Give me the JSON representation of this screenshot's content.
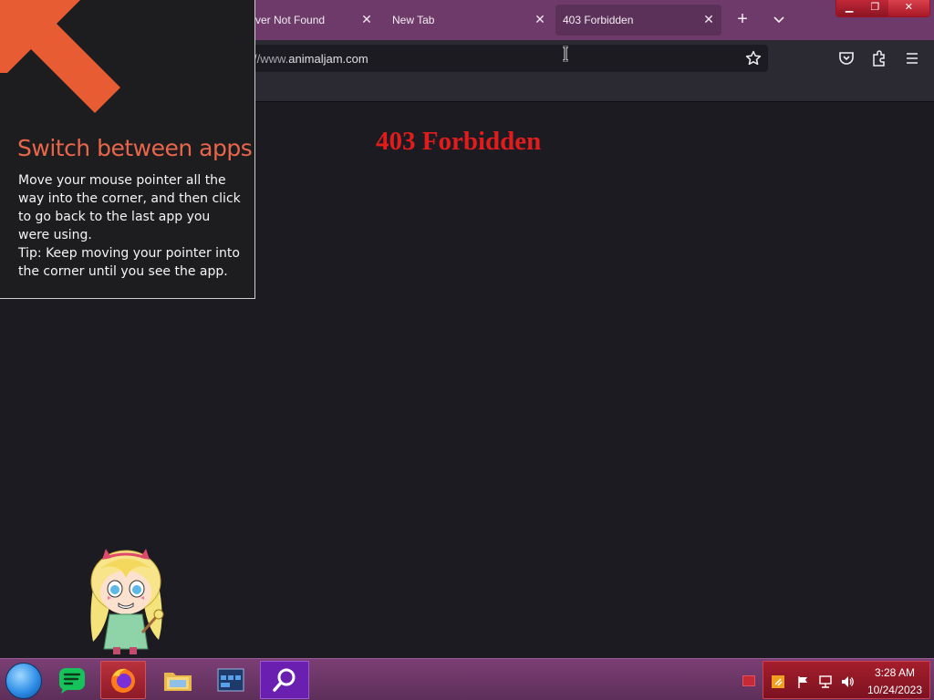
{
  "browser": {
    "tabs": [
      {
        "title": "ver Not Found",
        "close": "✕",
        "active": false
      },
      {
        "title": "New Tab",
        "close": "✕",
        "active": false
      },
      {
        "title": "403 Forbidden",
        "close": "✕",
        "active": true
      }
    ],
    "new_tab_label": "+",
    "address": {
      "prefix": "//www.",
      "domain": "animaljam.com"
    }
  },
  "page": {
    "heading": "403 Forbidden"
  },
  "tip": {
    "title": "Switch between apps",
    "lines": [
      "Move your mouse pointer all the way into the corner, and then click to go back to the last app you were using.",
      "Tip: Keep moving your pointer into the corner until you see the app."
    ]
  },
  "taskbar": {
    "apps": [
      "chat-app-icon",
      "firefox-icon",
      "file-explorer-icon",
      "window-manager-icon",
      "search-app-icon"
    ],
    "clock_time": "3:28 AM",
    "clock_date": "10/24/2023"
  },
  "colors": {
    "accent": "#6e3a6a",
    "heading": "#e01c1c",
    "tip_title": "#e8664a",
    "tray": "#a51e2c"
  }
}
